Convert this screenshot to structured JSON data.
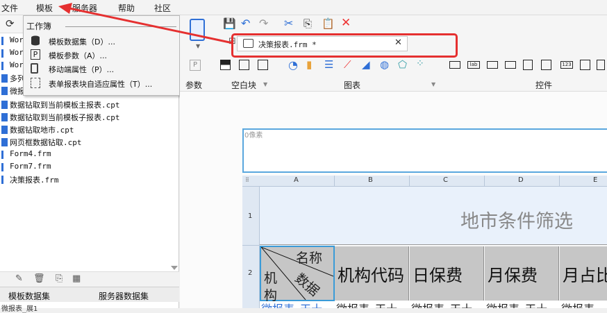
{
  "menubar": {
    "items": [
      "文件",
      "模板",
      "服务器",
      "帮助",
      "社区"
    ]
  },
  "template_menu": {
    "section": "工作簿",
    "items": [
      "模板数据集（D）...",
      "模板参数（A）...",
      "移动端属性（P）...",
      "表单报表块自适应属性（T）..."
    ]
  },
  "file_tree": {
    "partial": [
      "Wor",
      "Wor",
      "Wor",
      "多列",
      "微报"
    ],
    "items": [
      {
        "name": "数据钻取到当前模板主报表.cpt",
        "type": "cpt"
      },
      {
        "name": "数据钻取到当前模板子报表.cpt",
        "type": "cpt"
      },
      {
        "name": "数据钻取地市.cpt",
        "type": "cpt"
      },
      {
        "name": "网页框数据钻取.cpt",
        "type": "cpt"
      },
      {
        "name": "Form4.frm",
        "type": "frm"
      },
      {
        "name": "Form7.frm",
        "type": "frm"
      },
      {
        "name": "决策报表.frm",
        "type": "frm"
      }
    ]
  },
  "bottom_tabs": [
    "模板数据集",
    "服务器数据集"
  ],
  "bottom_partial": "微报表_展1",
  "doc_tab": {
    "title": "决策报表.frm *"
  },
  "toolbar_groups": [
    "参数",
    "空白块",
    "图表",
    "控件"
  ],
  "canvas": {
    "pixel_label": "0像素",
    "columns": [
      "A",
      "B",
      "C",
      "D",
      "E"
    ],
    "rows": [
      "1",
      "2"
    ],
    "title": "地市条件筛选",
    "diag": {
      "top": "名称",
      "mid": "数据",
      "left_top": "机",
      "left_bot": "构"
    },
    "headers": [
      "机构代码",
      "日保费",
      "月保费",
      "月占比"
    ],
    "row3_partial": [
      "微报表_天十",
      "微报表_天十",
      "微报表_天十",
      "微报表_天十",
      "微报表_"
    ]
  },
  "colors": {
    "accent": "#2f6fd6",
    "highlight": "#e53030",
    "header_fill": "#c6c6c6",
    "title_fill": "#e9f1fb"
  }
}
